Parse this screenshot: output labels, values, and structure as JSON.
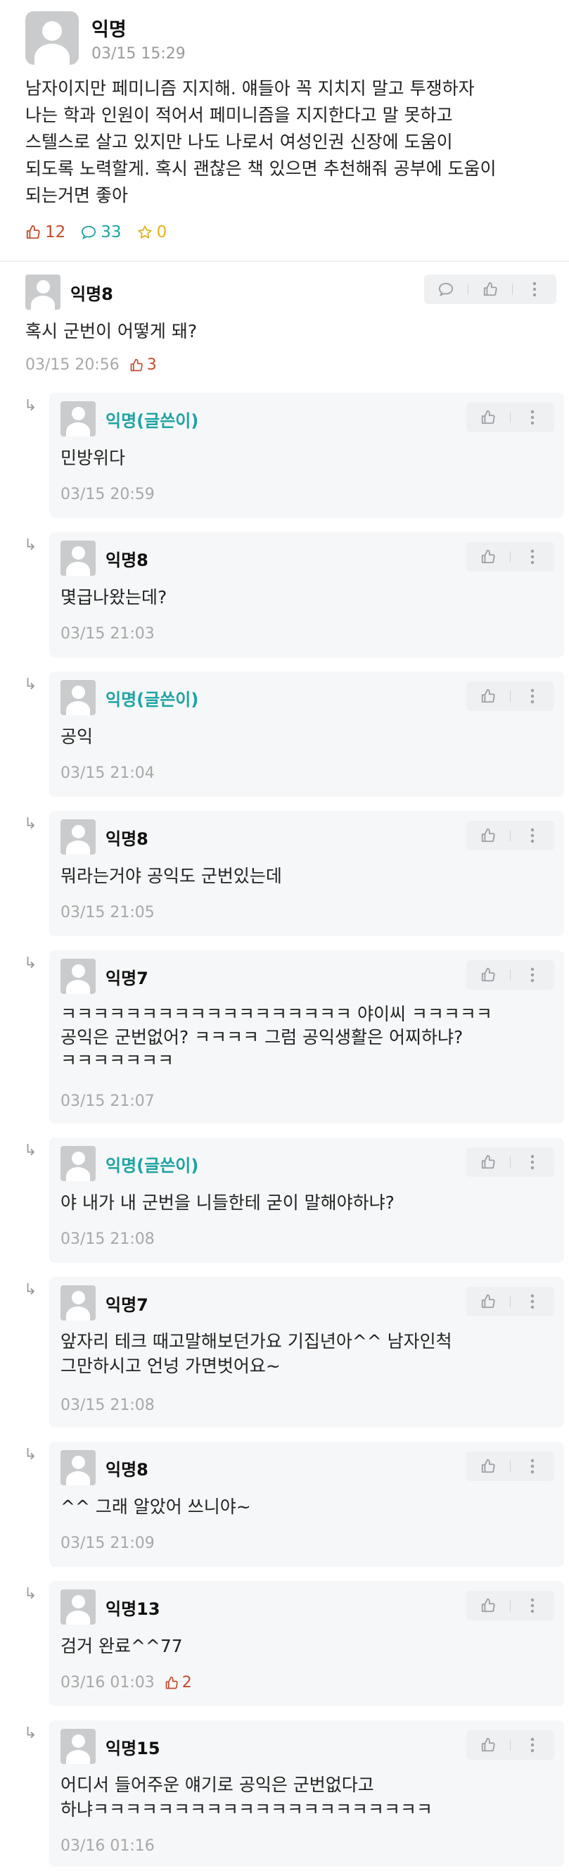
{
  "post": {
    "author": "익명",
    "time": "03/15 15:29",
    "body_lines": [
      "남자이지만 페미니즘 지지해. 얘들아 꼭 지치지 말고 투쟁하자",
      "나는 학과 인원이 적어서 페미니즘을 지지한다고 말 못하고",
      "스텔스로 살고 있지만 나도 나로서 여성인권 신장에 도움이",
      "되도록 노력할게. 혹시 괜찮은 책 있으면 추천해줘 공부에 도움이",
      "되는거면 좋아"
    ],
    "likes": "12",
    "comments": "33",
    "scraps": "0"
  },
  "comment": {
    "author": "익명8",
    "body": "혹시 군번이 어떻게 돼?",
    "time": "03/15 20:56",
    "likes": "3"
  },
  "replies": [
    {
      "author": "익명(글쓴이)",
      "body_lines": [
        "민방위다"
      ],
      "time": "03/15 20:59"
    },
    {
      "author": "익명8",
      "body_lines": [
        "몇급나왔는데?"
      ],
      "time": "03/15 21:03"
    },
    {
      "author": "익명(글쓴이)",
      "body_lines": [
        "공익"
      ],
      "time": "03/15 21:04"
    },
    {
      "author": "익명8",
      "body_lines": [
        "뭐라는거야 공익도 군번있는데"
      ],
      "time": "03/15 21:05"
    },
    {
      "author": "익명7",
      "body_lines": [
        "ㅋㅋㅋㅋㅋㅋㅋㅋㅋㅋㅋㅋㅋㅋㅋㅋㅋㅋ 야이씨 ㅋㅋㅋㅋㅋ",
        "공익은 군번없어? ㅋㅋㅋㅋ 그럼 공익생활은 어찌하냐?",
        "ㅋㅋㅋㅋㅋㅋㅋ"
      ],
      "time": "03/15 21:07"
    },
    {
      "author": "익명(글쓴이)",
      "body_lines": [
        "야 내가 내 군번을 니들한테 굳이 말해야하냐?"
      ],
      "time": "03/15 21:08"
    },
    {
      "author": "익명7",
      "body_lines": [
        "앞자리 테크 때고말해보던가요 기집년아^^ 남자인척",
        "그만하시고 언넝 가면벗어요~"
      ],
      "time": "03/15 21:08"
    },
    {
      "author": "익명8",
      "body_lines": [
        "^^ 그래 알았어 쓰니야~"
      ],
      "time": "03/15 21:09"
    },
    {
      "author": "익명13",
      "body_lines": [
        "검거 완료^^77"
      ],
      "time": "03/16 01:03",
      "likes": "2"
    },
    {
      "author": "익명15",
      "body_lines": [
        "어디서 들어주운 얘기로 공익은 군번없다고",
        "하냐ㅋㅋㅋㅋㅋㅋㅋㅋㅋㅋㅋㅋㅋㅋㅋㅋㅋㅋㅋㅋㅋ"
      ],
      "time": "03/16 01:16"
    }
  ],
  "icons": {
    "like": "thumbs-up-icon",
    "comment": "speech-bubble-icon",
    "scrap": "star-icon",
    "more": "vertical-dots-icon",
    "reply_arrow": "reply-arrow-icon",
    "avatar": "default-avatar-icon"
  },
  "colors": {
    "accent_op": "#1fa3a3",
    "like": "#c24b2d",
    "comment": "#1fa3a3",
    "scrap": "#e3b21b",
    "meta": "#a8a8a8",
    "reply_bg": "#f6f7f8"
  }
}
